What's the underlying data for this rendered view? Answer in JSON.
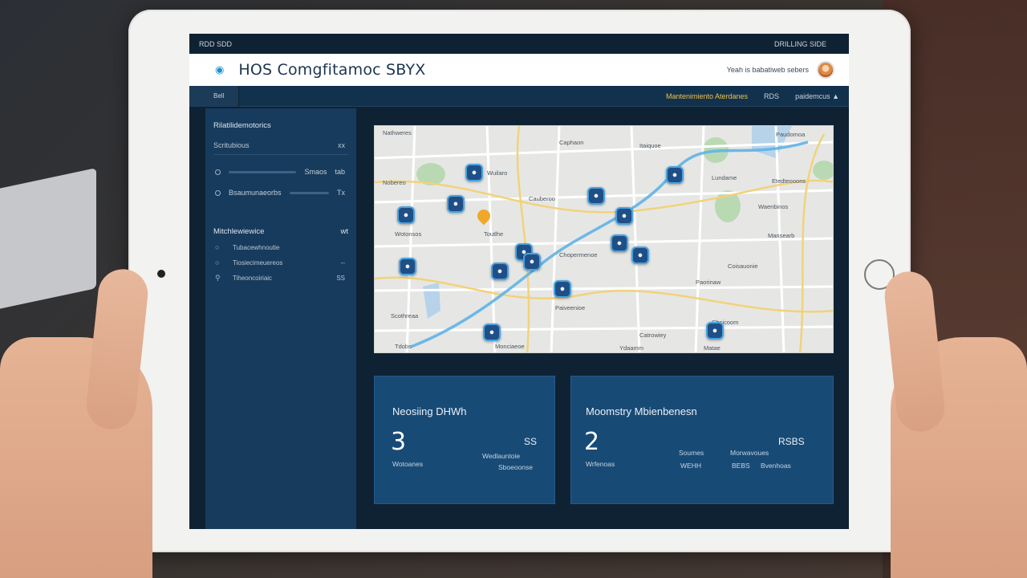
{
  "statusbar": {
    "left": "RDD SDD",
    "right": "DRILLING SIDE"
  },
  "header": {
    "title": "HOS Comgfitamoc SBYX",
    "status_text": "Yeah is babatiweb sebers",
    "logo_icon": "app-logo-icon",
    "avatar_icon": "user-avatar-icon"
  },
  "nav": {
    "tab": "Bell",
    "alert": "Mantenimiento Aterdanes",
    "item2": "RDS",
    "item3": "paidemcus ▲"
  },
  "sidebar": {
    "heading": "Rilatilidemotorics",
    "subheading": "Scritubious",
    "subheading_badge": "xx",
    "rows": [
      {
        "label": "Smaos",
        "value": "tab"
      },
      {
        "label": "Bsaumunaeorbs",
        "value": "Tx"
      }
    ],
    "section": "Mitchlewiewice",
    "section_badge": "wt",
    "items": [
      {
        "label": "Tubacewhnoutie",
        "icon": "circle-icon",
        "value": ""
      },
      {
        "label": "Tiosiecimeuereos",
        "icon": "circle-icon",
        "value": "--"
      },
      {
        "label": "Tiheoncoiriaic",
        "icon": "location-icon",
        "value": "SS"
      }
    ]
  },
  "map": {
    "labels": [
      "Nathweres",
      "Caphaon",
      "Itaiquoe",
      "Paudomoa",
      "Wuilaro",
      "Nobereo",
      "Cauberoo",
      "Lundame",
      "Etedteooons",
      "Waenbinos",
      "Wotonsos",
      "Toutlhe",
      "Mansearb",
      "Chopermenoe",
      "Coisauonie",
      "Paorinaw",
      "Paiveenioe",
      "Scothreaa",
      "Chsicoom",
      "Catrowiey",
      "Tdobs",
      "Monciaeoe",
      "Ydaamm",
      "Matae"
    ],
    "pin_icon": "vehicle-icon",
    "marker_icon": "location-pin-icon"
  },
  "cards": [
    {
      "title": "Neosiing DHWh",
      "number": "3",
      "sub_left": "Wotoanes",
      "top_right": "SS",
      "mid_right": "Wedlauntoie",
      "bottom_right": "Sboeoonse"
    },
    {
      "title": "Moomstry Mbienbenesn",
      "number": "2",
      "sub_left": "Wrfenoas",
      "top_right": "RSBS",
      "mid_a": "Soumes",
      "mid_b": "Morwavoues",
      "bottom_a": "WEHH",
      "bottom_b": "BEBS",
      "bottom_c": "Bvenhoas"
    }
  ],
  "colors": {
    "accent": "#1f8fd1",
    "panel": "#173b5c",
    "card": "#184a76",
    "alert": "#f0c24a"
  }
}
